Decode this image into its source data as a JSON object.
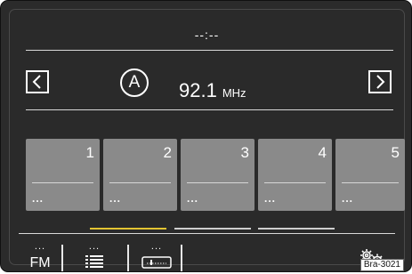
{
  "header": {
    "clock": "--:--"
  },
  "station": {
    "badge": "A",
    "frequency": "92.1",
    "unit": "MHz"
  },
  "presets": [
    {
      "number": "1",
      "name": "..."
    },
    {
      "number": "2",
      "name": "..."
    },
    {
      "number": "3",
      "name": "..."
    },
    {
      "number": "4",
      "name": "..."
    },
    {
      "number": "5",
      "name": "..."
    }
  ],
  "pager": {
    "pages": 3,
    "active_page": 1,
    "active_color": "#e3c432",
    "inactive_color": "#cfcfcf"
  },
  "toolbar": {
    "band_label": "FM",
    "band_more": "...",
    "list_more": "...",
    "tape_more": "...",
    "list_icon": "list-icon",
    "tape_icon": "tape-icon",
    "settings_icon": "settings-gears-icon"
  },
  "figure_ref": "Bra-3021",
  "colors": {
    "background": "#2b2b2b",
    "preset_tile": "#8a8a8a",
    "text": "#ffffff"
  }
}
